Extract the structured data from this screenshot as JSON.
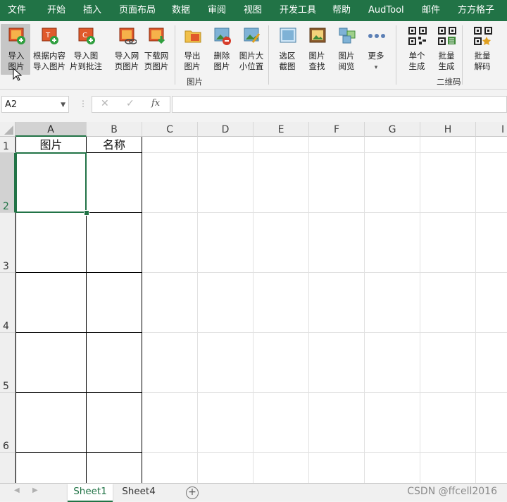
{
  "menu": [
    "文件",
    "开始",
    "插入",
    "页面布局",
    "数据",
    "审阅",
    "视图",
    "开发工具",
    "帮助",
    "AudTool",
    "邮件",
    "方方格子"
  ],
  "ribbon": {
    "buttons": [
      {
        "line1": "导入",
        "line2": "图片",
        "icon": "import-picture-icon"
      },
      {
        "line1": "根据内容",
        "line2": "导入图片",
        "icon": "import-by-content-icon"
      },
      {
        "line1": "导入图",
        "line2": "片到批注",
        "icon": "import-to-comment-icon"
      },
      {
        "line1": "导入网",
        "line2": "页图片",
        "icon": "import-web-picture-icon"
      },
      {
        "line1": "下载网",
        "line2": "页图片",
        "icon": "download-web-picture-icon"
      },
      {
        "line1": "导出",
        "line2": "图片",
        "icon": "export-picture-icon"
      },
      {
        "line1": "删除",
        "line2": "图片",
        "icon": "delete-picture-icon"
      },
      {
        "line1": "图片大",
        "line2": "小位置",
        "icon": "picture-size-icon"
      },
      {
        "line1": "选区",
        "line2": "截图",
        "icon": "screenshot-icon"
      },
      {
        "line1": "图片",
        "line2": "查找",
        "icon": "picture-search-icon"
      },
      {
        "line1": "图片",
        "line2": "阅览",
        "icon": "picture-view-icon"
      },
      {
        "line1": "更多",
        "line2": "▾",
        "icon": "more-icon"
      },
      {
        "line1": "单个",
        "line2": "生成",
        "icon": "qr-single-icon"
      },
      {
        "line1": "批量",
        "line2": "生成",
        "icon": "qr-batch-icon"
      },
      {
        "line1": "批量",
        "line2": "解码",
        "icon": "qr-decode-icon"
      }
    ],
    "group_picture": "图片",
    "group_qrcode": "二维码"
  },
  "formula": {
    "name_box": "A2",
    "cancel": "✕",
    "confirm": "✓",
    "fx": "fx",
    "value": ""
  },
  "grid": {
    "columns": [
      "A",
      "B",
      "C",
      "D",
      "E",
      "F",
      "G",
      "H",
      "I"
    ],
    "rows": [
      "1",
      "2",
      "3",
      "4",
      "5",
      "6"
    ],
    "cells": {
      "A1": "图片",
      "B1": "名称"
    },
    "selected_cell": "A2"
  },
  "sheets": {
    "tabs": [
      "Sheet1",
      "Sheet4"
    ],
    "active": "Sheet1",
    "add": "+"
  },
  "watermark": "CSDN @ffcell2016",
  "colors": {
    "brand": "#217346"
  }
}
